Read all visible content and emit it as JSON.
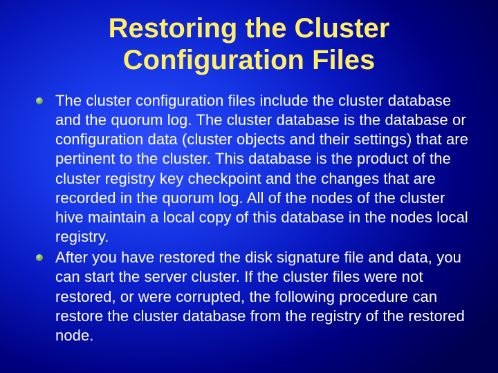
{
  "slide": {
    "title": "Restoring the Cluster Configuration Files",
    "bullets": [
      "The cluster configuration files include the cluster database and the quorum log. The cluster database is the database or configuration data (cluster objects and their settings) that are pertinent to the cluster. This database is the product of the cluster registry key checkpoint and the changes that are recorded in the quorum log. All of the nodes of the cluster hive maintain a local copy of this database in the nodes local registry.",
      "After you have restored the disk signature file and data, you can start the server cluster. If the cluster files were not restored, or were corrupted, the following procedure can restore the cluster database from the registry of the restored node."
    ]
  }
}
